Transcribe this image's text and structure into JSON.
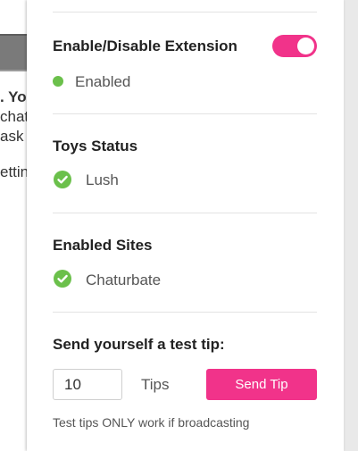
{
  "background_page": {
    "lines": [
      ". Yo",
      "chat",
      "ask u",
      "etting"
    ]
  },
  "extension": {
    "heading": "Enable/Disable Extension",
    "toggle_on": true,
    "status": "Enabled",
    "accent_color": "#f1338a",
    "status_color": "#6bc04b"
  },
  "toys": {
    "heading": "Toys Status",
    "items": [
      "Lush"
    ]
  },
  "sites": {
    "heading": "Enabled Sites",
    "items": [
      "Chaturbate"
    ]
  },
  "test_tip": {
    "heading": "Send yourself a test tip:",
    "amount": "10",
    "unit_label": "Tips",
    "button_label": "Send Tip",
    "note": "Test tips ONLY work if broadcasting"
  }
}
